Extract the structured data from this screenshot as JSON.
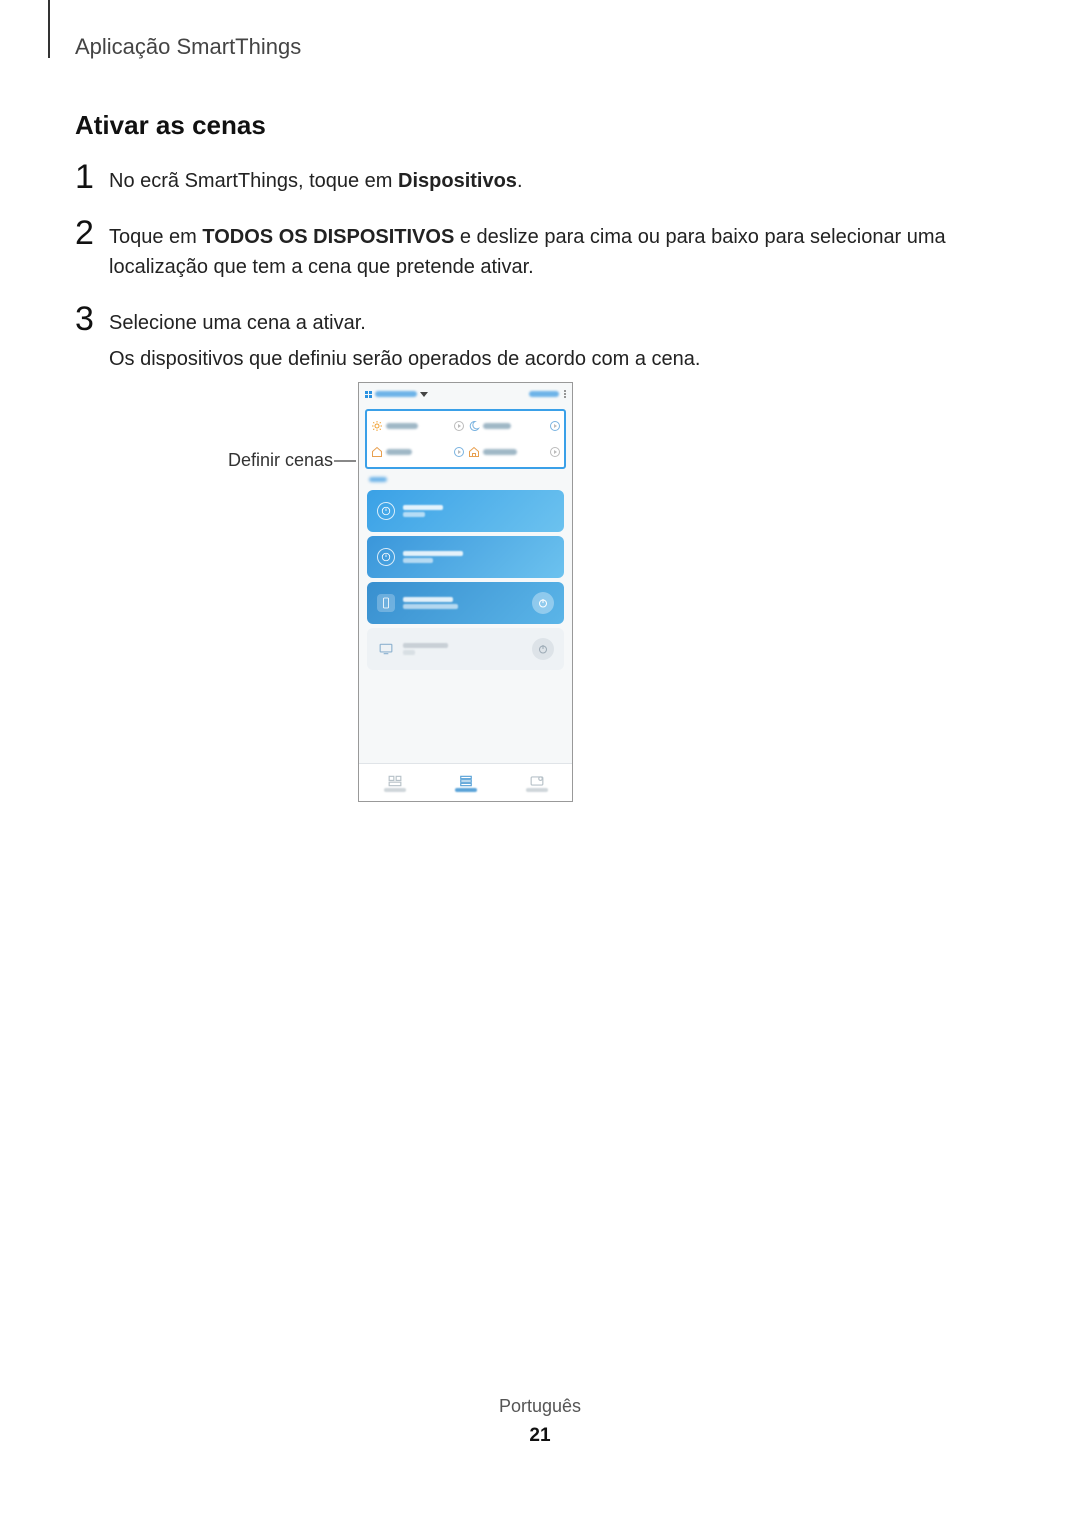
{
  "header": {
    "app_name": "Aplicação SmartThings"
  },
  "section": {
    "title": "Ativar as cenas"
  },
  "steps": [
    {
      "num": "1",
      "p1_a": "No ecrã SmartThings, toque em ",
      "p1_bold": "Dispositivos",
      "p1_b": "."
    },
    {
      "num": "2",
      "p1_a": "Toque em ",
      "p1_bold": "TODOS OS DISPOSITIVOS",
      "p1_b": " e deslize para cima ou para baixo para selecionar uma localização que tem a cena que pretende ativar."
    },
    {
      "num": "3",
      "p1": "Selecione uma cena a ativar.",
      "p2": "Os dispositivos que definiu serão operados de acordo com a cena."
    }
  ],
  "figure": {
    "callout": "Definir cenas"
  },
  "footer": {
    "language": "Português",
    "page": "21"
  }
}
